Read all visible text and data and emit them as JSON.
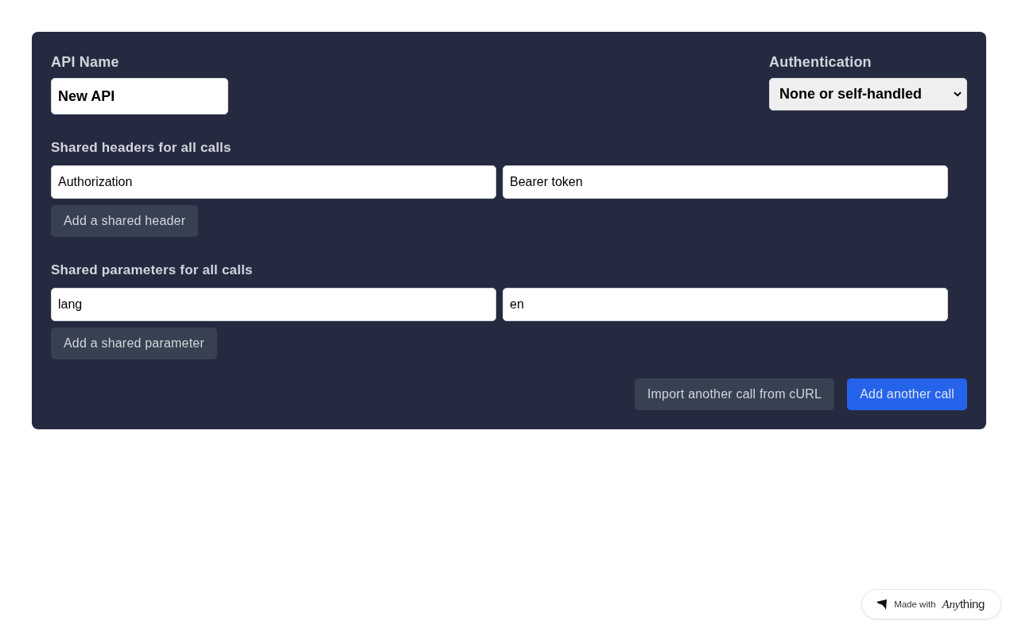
{
  "form": {
    "api_name": {
      "label": "API Name",
      "value": "New API"
    },
    "authentication": {
      "label": "Authentication",
      "value": "None or self-handled"
    },
    "sections": [
      {
        "title": "Shared headers for all calls",
        "rows": [
          {
            "key": "Authorization",
            "value": "Bearer token"
          }
        ],
        "add_button": "Add a shared header"
      },
      {
        "title": "Shared parameters for all calls",
        "rows": [
          {
            "key": "lang",
            "value": "en"
          }
        ],
        "add_button": "Add a shared parameter"
      }
    ],
    "actions": [
      {
        "label": "Import another call from cURL",
        "kind": "secondary"
      },
      {
        "label": "Add another call",
        "kind": "primary"
      }
    ]
  },
  "badge": {
    "prefix": "Made with",
    "logo": {
      "italic_part": "Any",
      "plain_part": "thing"
    }
  }
}
